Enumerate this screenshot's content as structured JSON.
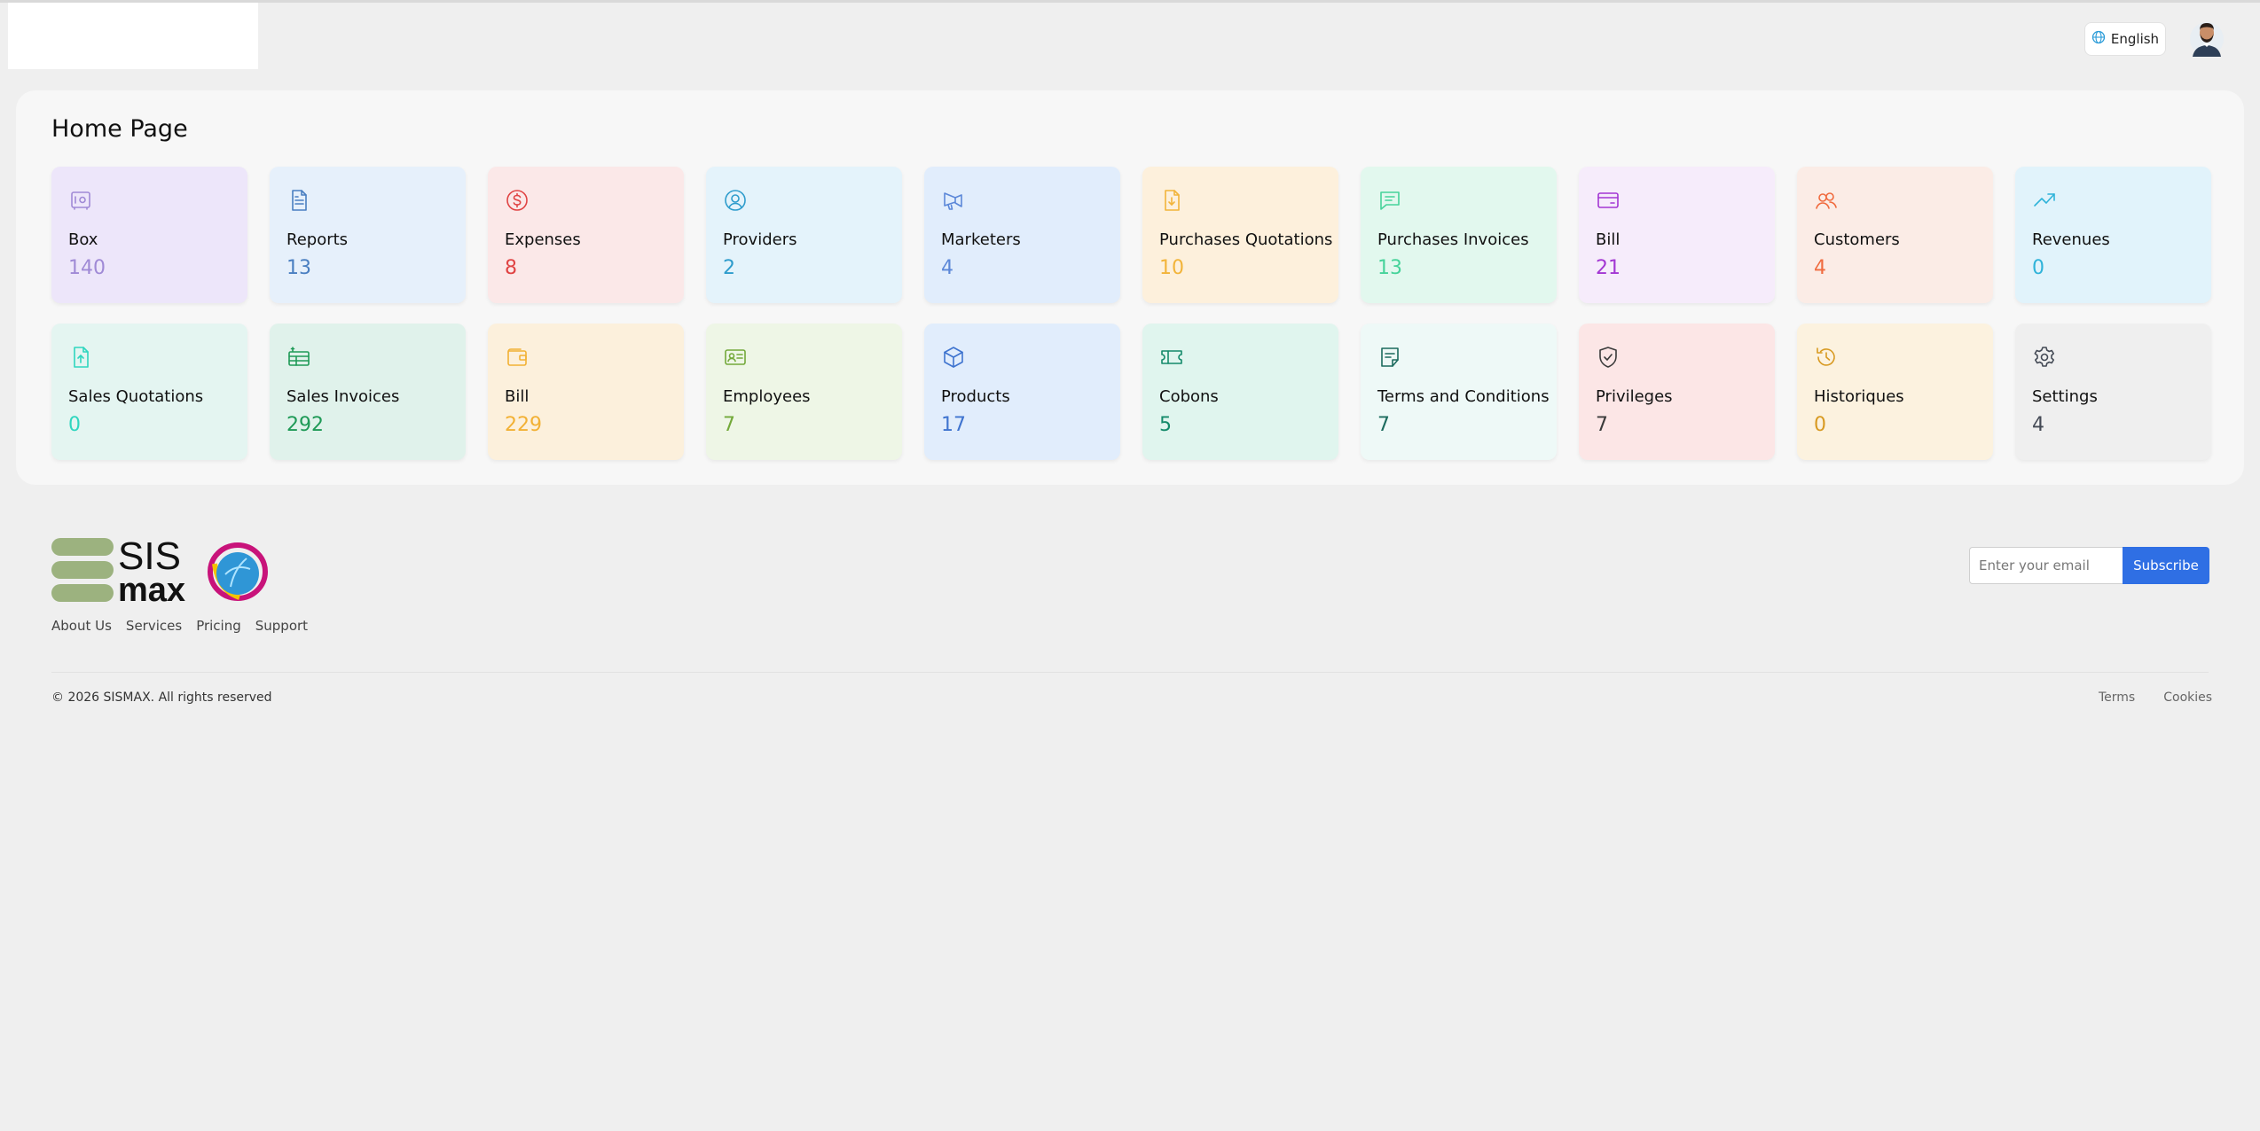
{
  "header": {
    "language_label": "English"
  },
  "main": {
    "title": "Home Page",
    "cards": [
      {
        "label": "Box",
        "value": "140",
        "icon": "safe-icon",
        "bg": "#ede6fa",
        "color": "#a08ad6"
      },
      {
        "label": "Reports",
        "value": "13",
        "icon": "document-icon",
        "bg": "#e6f0fb",
        "color": "#4a7fc1"
      },
      {
        "label": "Expenses",
        "value": "8",
        "icon": "dollar-circle-icon",
        "bg": "#fbe8e8",
        "color": "#e04343"
      },
      {
        "label": "Providers",
        "value": "2",
        "icon": "user-circle-icon",
        "bg": "#e4f3fb",
        "color": "#2e9ccc"
      },
      {
        "label": "Marketers",
        "value": "4",
        "icon": "megaphone-icon",
        "bg": "#e1edfc",
        "color": "#5b87d8"
      },
      {
        "label": "Purchases Quotations",
        "value": "10",
        "icon": "file-download-icon",
        "bg": "#fdf0dc",
        "color": "#f2b43a"
      },
      {
        "label": "Purchases Invoices",
        "value": "13",
        "icon": "message-icon",
        "bg": "#e2f8ee",
        "color": "#46d39a"
      },
      {
        "label": "Bill",
        "value": "21",
        "icon": "credit-card-icon",
        "bg": "#f6ecfb",
        "color": "#a337d3"
      },
      {
        "label": "Customers",
        "value": "4",
        "icon": "users-icon",
        "bg": "#fbece6",
        "color": "#f06b3f"
      },
      {
        "label": "Revenues",
        "value": "0",
        "icon": "trending-up-icon",
        "bg": "#e1f3fb",
        "color": "#2fb3d9"
      },
      {
        "label": "Sales Quotations",
        "value": "0",
        "icon": "file-upload-icon",
        "bg": "#e4f5f1",
        "color": "#2fd6bf"
      },
      {
        "label": "Sales Invoices",
        "value": "292",
        "icon": "invoice-icon",
        "bg": "#e0f2eb",
        "color": "#1f9a57"
      },
      {
        "label": "Bill",
        "value": "229",
        "icon": "wallet-icon",
        "bg": "#fcf0dc",
        "color": "#f2b135"
      },
      {
        "label": "Employees",
        "value": "7",
        "icon": "id-card-icon",
        "bg": "#eef6e6",
        "color": "#73a93a"
      },
      {
        "label": "Products",
        "value": "17",
        "icon": "cube-icon",
        "bg": "#e1edfc",
        "color": "#3f74cf"
      },
      {
        "label": "Cobons",
        "value": "5",
        "icon": "ticket-icon",
        "bg": "#e0f5ee",
        "color": "#148a6a"
      },
      {
        "label": "Terms and Conditions",
        "value": "7",
        "icon": "note-icon",
        "bg": "#eef9f7",
        "color": "#1c6b5e"
      },
      {
        "label": "Privileges",
        "value": "7",
        "icon": "shield-check-icon",
        "bg": "#fce6e6",
        "color": "#3a3a3a"
      },
      {
        "label": "Historiques",
        "value": "0",
        "icon": "history-icon",
        "bg": "#fcf2df",
        "color": "#d89a22"
      },
      {
        "label": "Settings",
        "value": "4",
        "icon": "gear-icon",
        "bg": "#efefef",
        "color": "#444a55"
      }
    ]
  },
  "footer": {
    "brand_top": "SIS",
    "brand_bottom": "max",
    "links": [
      "About Us",
      "Services",
      "Pricing",
      "Support"
    ],
    "email_placeholder": "Enter your email",
    "subscribe_label": "Subscribe",
    "copyright": "© 2026 SISMAX. All rights reserved",
    "legal": [
      "Terms",
      "Cookies"
    ]
  }
}
